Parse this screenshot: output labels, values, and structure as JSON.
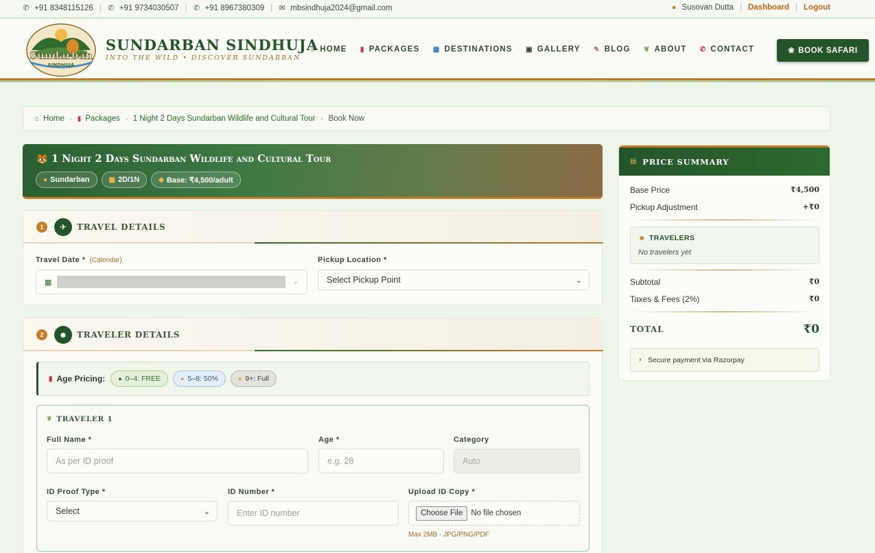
{
  "topbar": {
    "phones": [
      "+91 8348115126",
      "+91 9734030507",
      "+91 8967380309"
    ],
    "email": "mbsindhuja2024@gmail.com",
    "user_name": "Susovan Dutta",
    "dashboard": "Dashboard",
    "logout": "Logout"
  },
  "brand": {
    "logo_text": "Sundarban",
    "logo_subtext": "SINDHUJA",
    "name": "SUNDARBAN SINDHUJA",
    "tagline": "INTO THE WILD  •  DISCOVER SUNDARBAN"
  },
  "nav": {
    "items": [
      "HOME",
      "PACKAGES",
      "DESTINATIONS",
      "GALLERY",
      "BLOG",
      "ABOUT",
      "CONTACT"
    ],
    "book_button": "BOOK SAFARI"
  },
  "breadcrumb": {
    "home": "Home",
    "packages": "Packages",
    "tour": "1 Night 2 Days Sundarban Wildlife and Cultural Tour",
    "current": "Book Now"
  },
  "tour": {
    "title": "1 Night 2 Days Sundarban Wildlife and Cultural Tour",
    "location": "Sundarban",
    "duration": "2D/1N",
    "base": "Base: ₹4,500/adult"
  },
  "travel_details": {
    "number": "1",
    "title": "TRAVEL DETAILS",
    "date_label": "Travel Date *",
    "date_sub": "(Calendar)",
    "pickup_label": "Pickup Location *",
    "pickup_value": "Select Pickup Point"
  },
  "traveler_details": {
    "number": "2",
    "title": "TRAVELER DETAILS",
    "age_label": "Age Pricing:",
    "age_pills": [
      "0–4: FREE",
      "5–8: 50%",
      "9+: Full"
    ],
    "traveler_heading": "TRAVELER 1",
    "full_name_label": "Full Name *",
    "full_name_placeholder": "As per ID proof",
    "age_field_label": "Age *",
    "age_placeholder": "e.g. 28",
    "category_label": "Category",
    "category_placeholder": "Auto",
    "id_type_label": "ID Proof Type *",
    "id_type_value": "Select",
    "id_number_label": "ID Number *",
    "id_number_placeholder": "Enter ID number",
    "upload_label": "Upload ID Copy *",
    "choose_file": "Choose File",
    "no_file": "No file chosen",
    "upload_hint": "Max 2MB · JPG/PNG/PDF"
  },
  "summary": {
    "title": "PRICE SUMMARY",
    "base_label": "Base Price",
    "base_value": "₹4,500",
    "pickup_label": "Pickup Adjustment",
    "pickup_value": "+₹0",
    "travelers_title": "TRAVELERS",
    "travelers_empty": "No travelers yet",
    "subtotal_label": "Subtotal",
    "subtotal_value": "₹0",
    "taxes_label": "Taxes & Fees (2%)",
    "taxes_value": "₹0",
    "total_label": "TOTAL",
    "total_value": "₹0",
    "secure_text": "Secure payment via Razorpay"
  },
  "colors": {
    "primary_green": "#24552a",
    "accent_orange": "#c67d2a",
    "background": "#eef5e9"
  }
}
